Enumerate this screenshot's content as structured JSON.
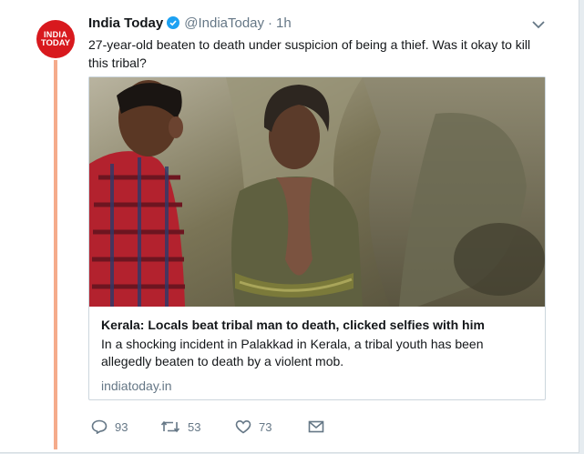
{
  "tweet": {
    "avatar_logo": [
      "INDIA",
      "TODAY"
    ],
    "author_name": "India Today",
    "handle": "@IndiaToday",
    "separator": "·",
    "time": "1h",
    "text": "27-year-old beaten to death under suspicion of being a thief. Was it okay to kill this tribal?",
    "card": {
      "title": "Kerala: Locals beat tribal man to death, clicked selfies with him",
      "description": "In a shocking incident in Palakkad in Kerala, a tribal youth has been allegedly beaten to death by a violent mob.",
      "domain": "indiatoday.in"
    },
    "actions": {
      "replies": "93",
      "retweets": "53",
      "likes": "73"
    }
  },
  "colors": {
    "brand_red": "#d8191e",
    "verified_blue": "#1da1f2",
    "thread_line": "#f5ab8b",
    "muted_text": "#657786"
  },
  "icons": [
    "verified-badge-icon",
    "chevron-down-icon",
    "reply-icon",
    "retweet-icon",
    "heart-icon",
    "envelope-icon"
  ]
}
